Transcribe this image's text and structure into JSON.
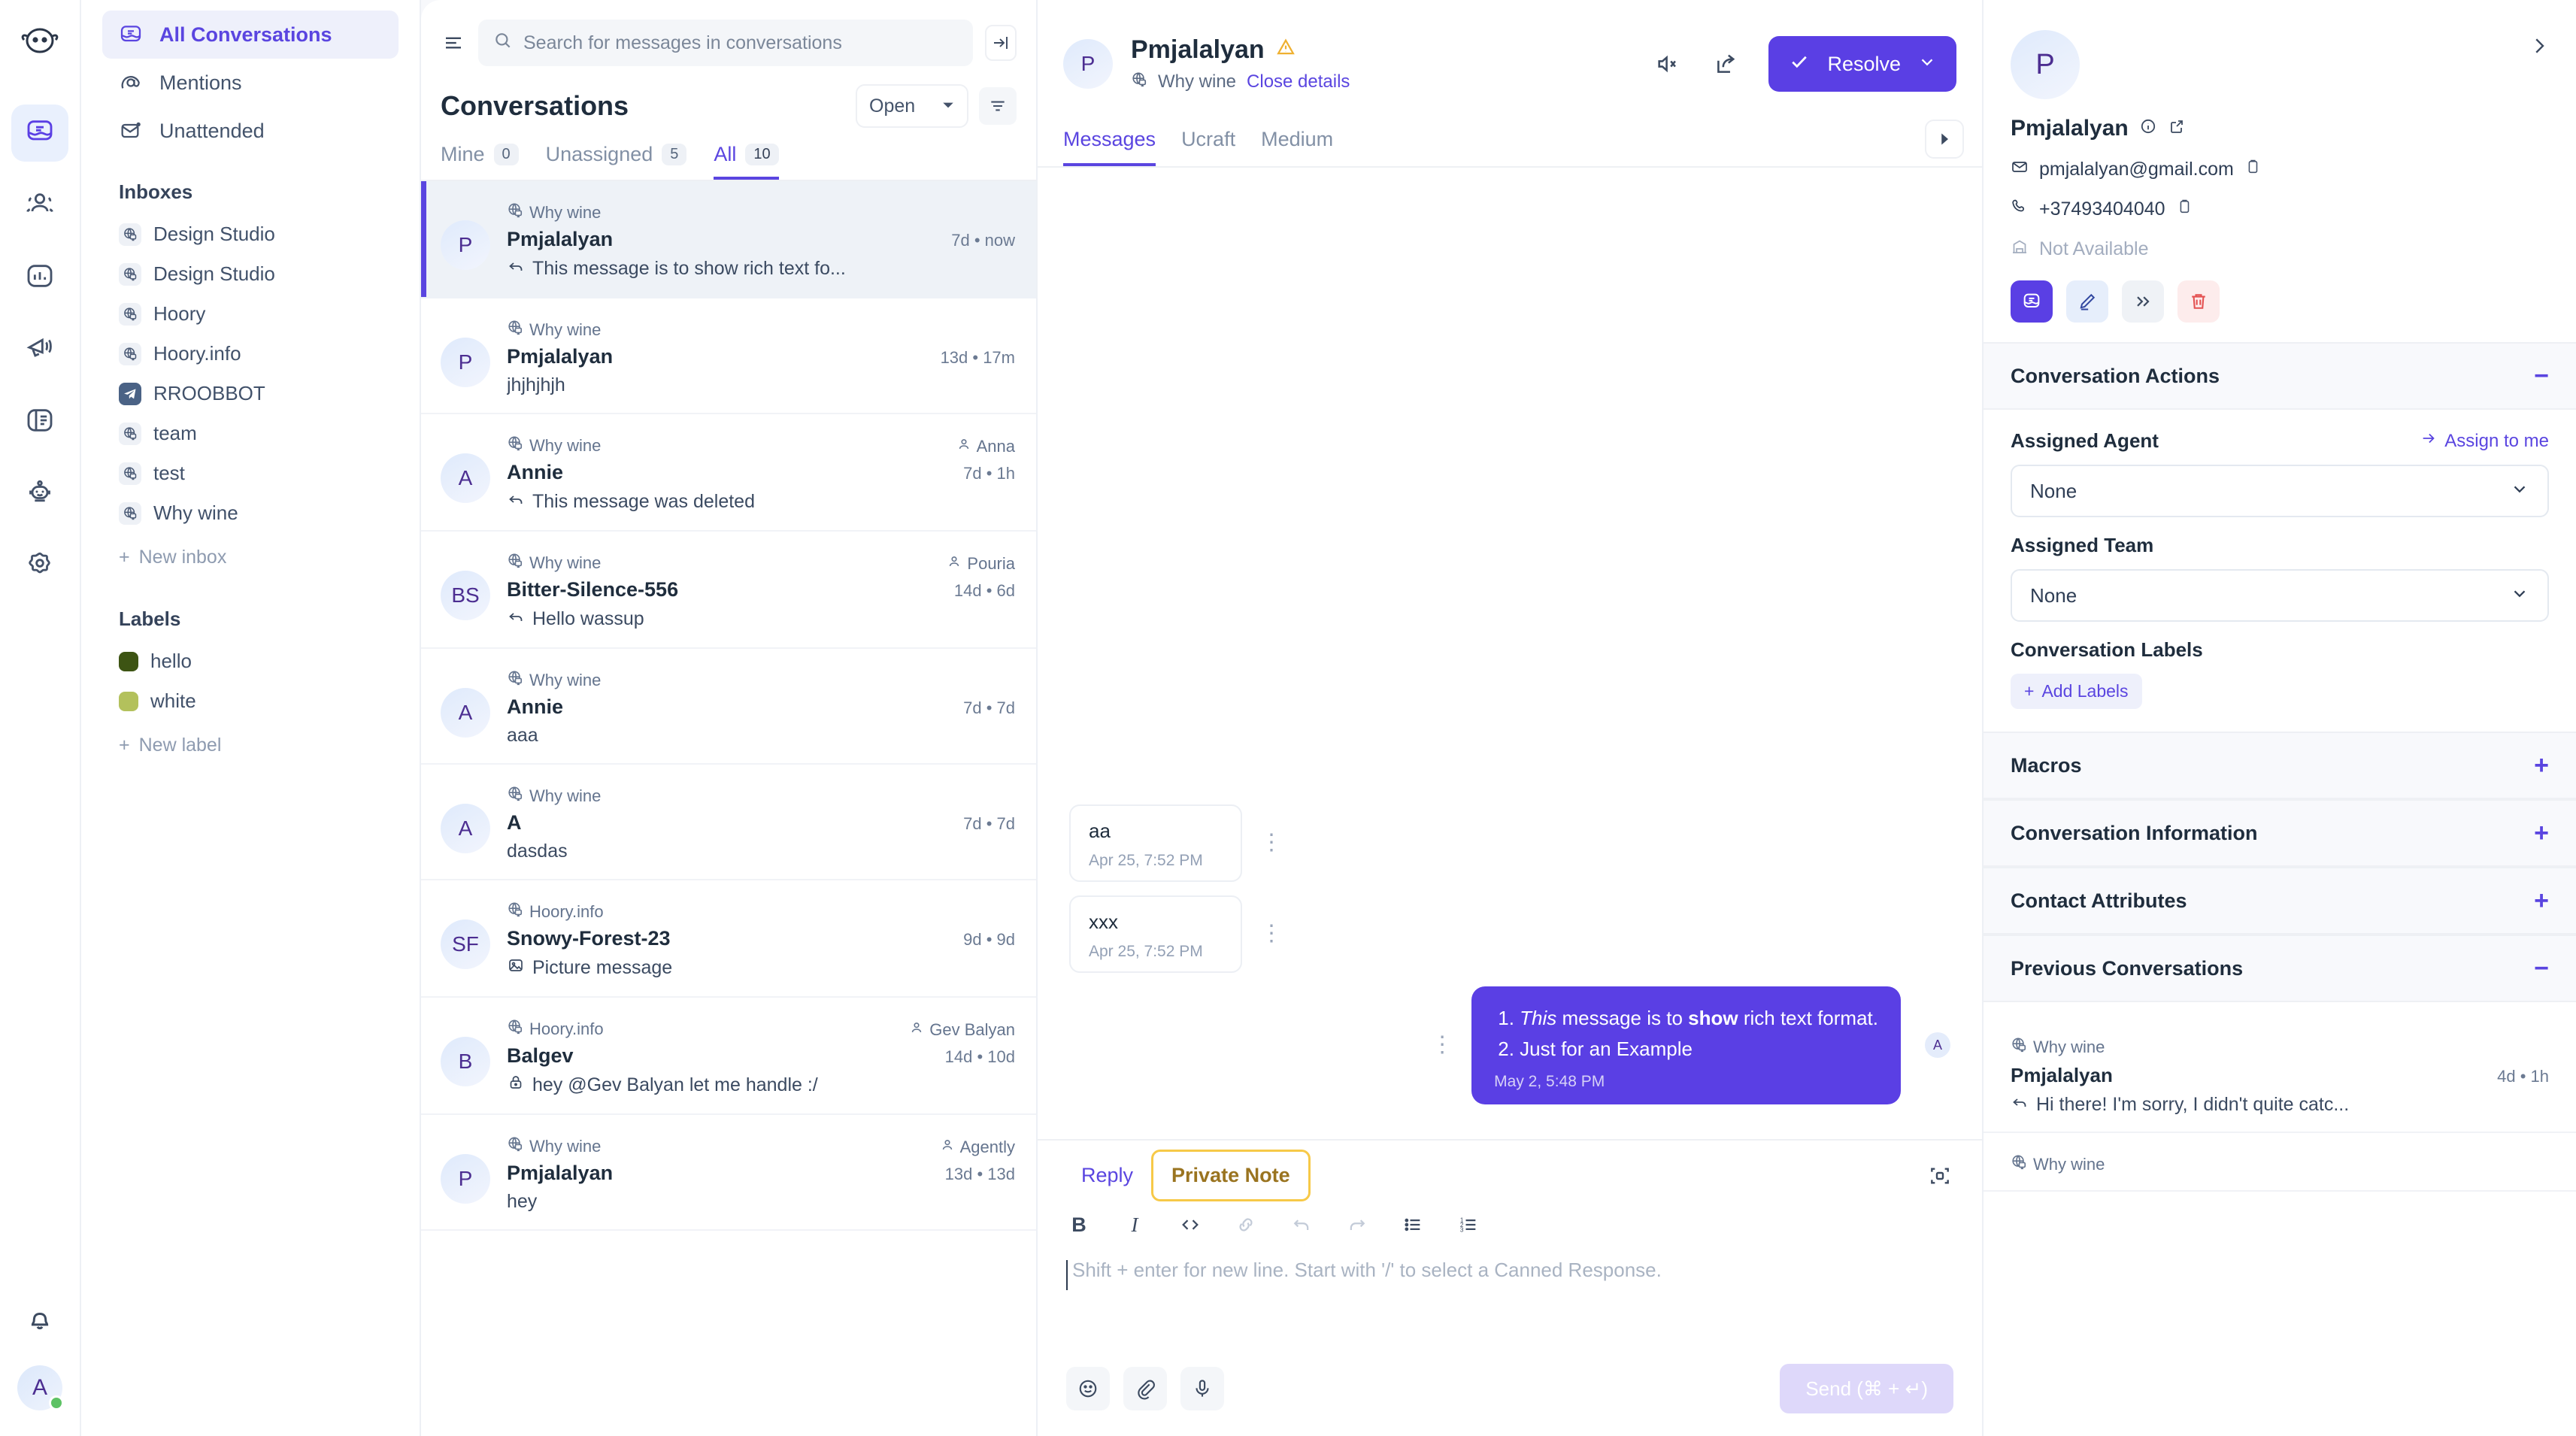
{
  "rail": {
    "logo_icon": "hoory-logo-icon",
    "items": [
      {
        "icon": "conversations-icon",
        "name": "rail-conversations",
        "active": true
      },
      {
        "icon": "contacts-icon",
        "name": "rail-contacts",
        "active": false
      },
      {
        "icon": "reports-icon",
        "name": "rail-reports",
        "active": false
      },
      {
        "icon": "campaigns-icon",
        "name": "rail-campaigns",
        "active": false
      },
      {
        "icon": "portal-icon",
        "name": "rail-portal",
        "active": false
      },
      {
        "icon": "bot-icon",
        "name": "rail-bot",
        "active": false
      },
      {
        "icon": "settings-icon",
        "name": "rail-settings",
        "active": false
      }
    ],
    "bell_icon": "notifications-bell-icon",
    "avatar_initial": "A"
  },
  "sidebar": {
    "nav": [
      {
        "label": "All Conversations",
        "icon": "conversations-icon",
        "active": true
      },
      {
        "label": "Mentions",
        "icon": "at-mention-icon",
        "active": false
      },
      {
        "label": "Unattended",
        "icon": "unattended-envelope-icon",
        "active": false
      }
    ],
    "inboxes_title": "Inboxes",
    "inboxes": [
      {
        "label": "Design Studio",
        "type": "web"
      },
      {
        "label": "Design Studio",
        "type": "web"
      },
      {
        "label": "Hoory",
        "type": "web"
      },
      {
        "label": "Hoory.info",
        "type": "web"
      },
      {
        "label": "RROOBBOT",
        "type": "telegram"
      },
      {
        "label": "team",
        "type": "web"
      },
      {
        "label": "test",
        "type": "web"
      },
      {
        "label": "Why wine",
        "type": "web"
      }
    ],
    "new_inbox_label": "New inbox",
    "labels_title": "Labels",
    "labels": [
      {
        "label": "hello",
        "color": "#3d5413"
      },
      {
        "label": "white",
        "color": "#b3c15c"
      }
    ],
    "new_label_label": "New label"
  },
  "conversation_list": {
    "search_placeholder": "Search for messages in conversations",
    "title": "Conversations",
    "status_filter": "Open",
    "tabs": [
      {
        "label": "Mine",
        "count": "0",
        "active": false
      },
      {
        "label": "Unassigned",
        "count": "5",
        "active": false
      },
      {
        "label": "All",
        "count": "10",
        "active": true
      }
    ],
    "items": [
      {
        "inbox": "Why wine",
        "name": "Pmjalalyan",
        "initials": "P",
        "time": "7d • now",
        "preview": "This message is to show rich text fo...",
        "preview_icon": "reply-arrow-icon",
        "assignee": "",
        "selected": true
      },
      {
        "inbox": "Why wine",
        "name": "Pmjalalyan",
        "initials": "P",
        "time": "13d • 17m",
        "preview": "jhjhjhjh",
        "preview_icon": "",
        "assignee": "",
        "selected": false
      },
      {
        "inbox": "Why wine",
        "name": "Annie",
        "initials": "A",
        "time": "7d • 1h",
        "preview": "This message was deleted",
        "preview_icon": "reply-arrow-icon",
        "assignee": "Anna",
        "selected": false
      },
      {
        "inbox": "Why wine",
        "name": "Bitter-Silence-556",
        "initials": "BS",
        "time": "14d • 6d",
        "preview": "Hello wassup",
        "preview_icon": "reply-arrow-icon",
        "assignee": "Pouria",
        "selected": false
      },
      {
        "inbox": "Why wine",
        "name": "Annie",
        "initials": "A",
        "time": "7d • 7d",
        "preview": "aaa",
        "preview_icon": "",
        "assignee": "",
        "selected": false
      },
      {
        "inbox": "Why wine",
        "name": "A",
        "initials": "A",
        "time": "7d • 7d",
        "preview": "dasdas",
        "preview_icon": "",
        "assignee": "",
        "selected": false
      },
      {
        "inbox": "Hoory.info",
        "name": "Snowy-Forest-23",
        "initials": "SF",
        "time": "9d • 9d",
        "preview": "Picture message",
        "preview_icon": "image-icon",
        "assignee": "",
        "selected": false
      },
      {
        "inbox": "Hoory.info",
        "name": "Balgev",
        "initials": "B",
        "time": "14d • 10d",
        "preview": "hey @Gev Balyan let me handle :/",
        "preview_icon": "lock-icon",
        "assignee": "Gev Balyan",
        "selected": false
      },
      {
        "inbox": "Why wine",
        "name": "Pmjalalyan",
        "initials": "P",
        "time": "13d • 13d",
        "preview": "hey",
        "preview_icon": "",
        "assignee": "Agently",
        "selected": false
      }
    ]
  },
  "chat": {
    "contact_name": "Pmjalalyan",
    "contact_initial": "P",
    "warning_icon": "warning-triangle-icon",
    "inbox": "Why wine",
    "close_details_label": "Close details",
    "mute_icon": "mute-speaker-icon",
    "share_icon": "share-icon",
    "resolve_label": "Resolve",
    "tabs": [
      {
        "label": "Messages",
        "active": true
      },
      {
        "label": "Ucraft",
        "active": false
      },
      {
        "label": "Medium",
        "active": false
      }
    ],
    "messages": [
      {
        "dir": "in",
        "text": "aa",
        "time": "Apr 25, 7:52 PM"
      },
      {
        "dir": "in",
        "text": "xxx",
        "time": "Apr 25, 7:52 PM"
      },
      {
        "dir": "out",
        "time": "May 2, 5:48 PM",
        "rich": [
          {
            "prefix": "",
            "italic": "This",
            "mid": " message is to ",
            "bold": "show",
            "suffix": " rich text format."
          },
          {
            "prefix": "Just for an Example",
            "italic": "",
            "mid": "",
            "bold": "",
            "suffix": ""
          }
        ],
        "agent_initial": "A"
      }
    ]
  },
  "editor": {
    "reply_tab": "Reply",
    "note_tab": "Private Note",
    "expand_icon": "expand-icon",
    "toolbar": [
      {
        "icon": "bold-icon",
        "glyph": "B",
        "dim": false
      },
      {
        "icon": "italic-icon",
        "glyph": "I",
        "dim": false
      },
      {
        "icon": "code-icon",
        "glyph": "</>",
        "dim": false
      },
      {
        "icon": "link-icon",
        "glyph": "⚭",
        "dim": true
      },
      {
        "icon": "undo-icon",
        "glyph": "↶",
        "dim": true
      },
      {
        "icon": "redo-icon",
        "glyph": "↷",
        "dim": true
      },
      {
        "icon": "bullet-list-icon",
        "glyph": "☰",
        "dim": false
      },
      {
        "icon": "numbered-list-icon",
        "glyph": "≡",
        "dim": false
      }
    ],
    "placeholder": "Shift + enter for new line. Start with '/' to select a Canned Response.",
    "emoji_icon": "emoji-icon",
    "attach_icon": "attachment-icon",
    "mic_icon": "microphone-icon",
    "send_label": "Send (⌘ + ↵)"
  },
  "right_panel": {
    "avatar_initial": "P",
    "name": "Pmjalalyan",
    "info_icon": "info-circle-icon",
    "external_icon": "external-link-icon",
    "expand_chevron_icon": "chevron-right-icon",
    "email": "pmjalalyan@gmail.com",
    "phone": "+37493404040",
    "company": "Not Available",
    "copy_icon": "copy-icon",
    "email_icon": "envelope-icon",
    "phone_icon": "phone-icon",
    "company_icon": "building-icon",
    "actions": [
      {
        "icon": "conversations-icon",
        "style": "primary"
      },
      {
        "icon": "edit-pen-icon",
        "style": "light"
      },
      {
        "icon": "merge-icon",
        "style": "gray"
      },
      {
        "icon": "delete-trash-icon",
        "style": "danger"
      }
    ],
    "sections": [
      {
        "title": "Conversation Actions",
        "expanded": true,
        "sign": "−"
      },
      {
        "title": "Macros",
        "expanded": false,
        "sign": "+"
      },
      {
        "title": "Conversation Information",
        "expanded": false,
        "sign": "+"
      },
      {
        "title": "Contact Attributes",
        "expanded": false,
        "sign": "+"
      },
      {
        "title": "Previous Conversations",
        "expanded": true,
        "sign": "−"
      }
    ],
    "assigned_agent_label": "Assigned Agent",
    "assign_to_me_label": "Assign to me",
    "assigned_agent_value": "None",
    "assigned_team_label": "Assigned Team",
    "assigned_team_value": "None",
    "conversation_labels_label": "Conversation Labels",
    "add_labels_label": "Add Labels",
    "previous_conversations": [
      {
        "inbox": "Why wine",
        "name": "Pmjalalyan",
        "time": "4d • 1h",
        "preview": "Hi there! I'm sorry, I didn't quite catc..."
      },
      {
        "inbox": "Why wine",
        "name": "",
        "time": "",
        "preview": ""
      }
    ]
  },
  "colors": {
    "accent": "#5a3fe4",
    "accent_light": "#eef0fb",
    "note_yellow": "#f7c948",
    "danger": "#e45151",
    "online_green": "#5dc264"
  }
}
